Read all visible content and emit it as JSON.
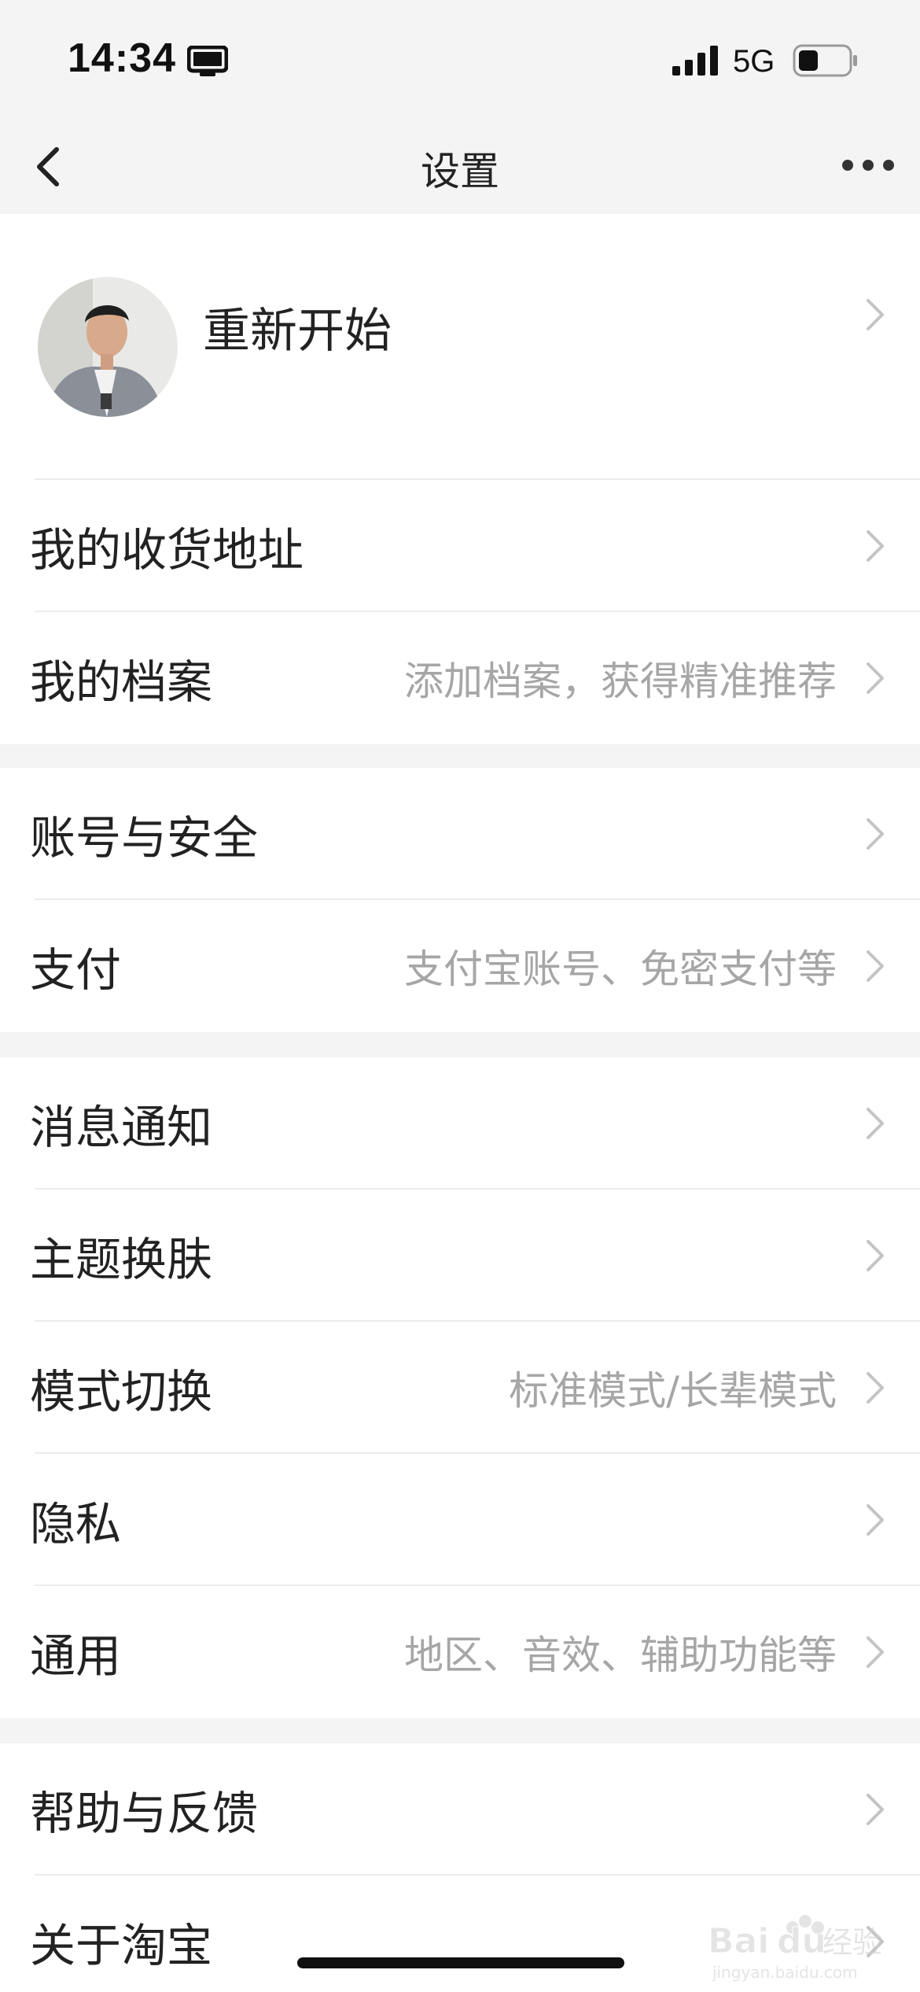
{
  "status_bar": {
    "time": "14:34",
    "network": "5G",
    "icons": [
      "screen-mirroring-icon",
      "signal-icon",
      "battery-icon"
    ]
  },
  "nav": {
    "title": "设置",
    "back_icon": "chevron-left-icon",
    "more_icon": "more-dots-icon"
  },
  "profile": {
    "name": "重新开始"
  },
  "groups": [
    {
      "items": [
        {
          "label": "我的收货地址",
          "hint": ""
        },
        {
          "label": "我的档案",
          "hint": "添加档案，获得精准推荐"
        }
      ]
    },
    {
      "items": [
        {
          "label": "账号与安全",
          "hint": ""
        },
        {
          "label": "支付",
          "hint": "支付宝账号、免密支付等"
        }
      ]
    },
    {
      "items": [
        {
          "label": "消息通知",
          "hint": ""
        },
        {
          "label": "主题换肤",
          "hint": ""
        },
        {
          "label": "模式切换",
          "hint": "标准模式/长辈模式"
        },
        {
          "label": "隐私",
          "hint": ""
        },
        {
          "label": "通用",
          "hint": "地区、音效、辅助功能等"
        }
      ]
    },
    {
      "items": [
        {
          "label": "帮助与反馈",
          "hint": ""
        },
        {
          "label": "关于淘宝",
          "hint": ""
        }
      ]
    }
  ],
  "watermark": {
    "brand": "Baidu经验",
    "site": "jingyan.baidu.com"
  },
  "colors": {
    "background": "#f4f4f4",
    "card": "#ffffff",
    "text": "#222222",
    "hint": "#a6a6a6",
    "divider": "#ececec"
  }
}
